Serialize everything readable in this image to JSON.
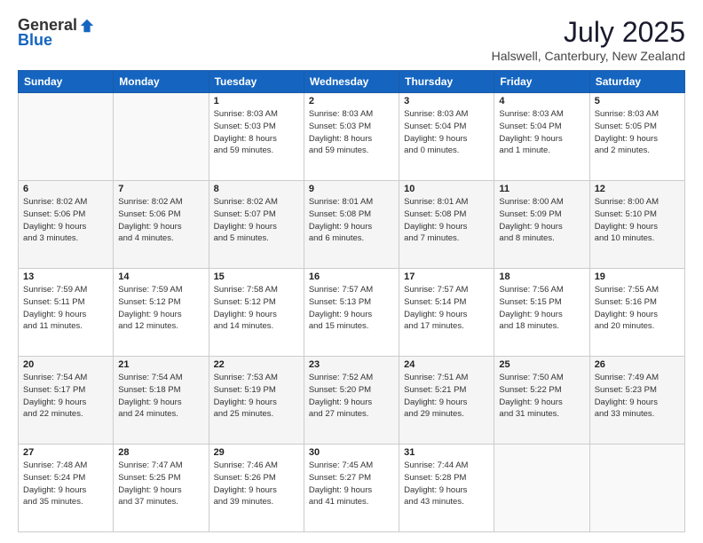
{
  "logo": {
    "general": "General",
    "blue": "Blue"
  },
  "header": {
    "month": "July 2025",
    "location": "Halswell, Canterbury, New Zealand"
  },
  "weekdays": [
    "Sunday",
    "Monday",
    "Tuesday",
    "Wednesday",
    "Thursday",
    "Friday",
    "Saturday"
  ],
  "weeks": [
    [
      {
        "day": "",
        "text": ""
      },
      {
        "day": "",
        "text": ""
      },
      {
        "day": "1",
        "text": "Sunrise: 8:03 AM\nSunset: 5:03 PM\nDaylight: 8 hours\nand 59 minutes."
      },
      {
        "day": "2",
        "text": "Sunrise: 8:03 AM\nSunset: 5:03 PM\nDaylight: 8 hours\nand 59 minutes."
      },
      {
        "day": "3",
        "text": "Sunrise: 8:03 AM\nSunset: 5:04 PM\nDaylight: 9 hours\nand 0 minutes."
      },
      {
        "day": "4",
        "text": "Sunrise: 8:03 AM\nSunset: 5:04 PM\nDaylight: 9 hours\nand 1 minute."
      },
      {
        "day": "5",
        "text": "Sunrise: 8:03 AM\nSunset: 5:05 PM\nDaylight: 9 hours\nand 2 minutes."
      }
    ],
    [
      {
        "day": "6",
        "text": "Sunrise: 8:02 AM\nSunset: 5:06 PM\nDaylight: 9 hours\nand 3 minutes."
      },
      {
        "day": "7",
        "text": "Sunrise: 8:02 AM\nSunset: 5:06 PM\nDaylight: 9 hours\nand 4 minutes."
      },
      {
        "day": "8",
        "text": "Sunrise: 8:02 AM\nSunset: 5:07 PM\nDaylight: 9 hours\nand 5 minutes."
      },
      {
        "day": "9",
        "text": "Sunrise: 8:01 AM\nSunset: 5:08 PM\nDaylight: 9 hours\nand 6 minutes."
      },
      {
        "day": "10",
        "text": "Sunrise: 8:01 AM\nSunset: 5:08 PM\nDaylight: 9 hours\nand 7 minutes."
      },
      {
        "day": "11",
        "text": "Sunrise: 8:00 AM\nSunset: 5:09 PM\nDaylight: 9 hours\nand 8 minutes."
      },
      {
        "day": "12",
        "text": "Sunrise: 8:00 AM\nSunset: 5:10 PM\nDaylight: 9 hours\nand 10 minutes."
      }
    ],
    [
      {
        "day": "13",
        "text": "Sunrise: 7:59 AM\nSunset: 5:11 PM\nDaylight: 9 hours\nand 11 minutes."
      },
      {
        "day": "14",
        "text": "Sunrise: 7:59 AM\nSunset: 5:12 PM\nDaylight: 9 hours\nand 12 minutes."
      },
      {
        "day": "15",
        "text": "Sunrise: 7:58 AM\nSunset: 5:12 PM\nDaylight: 9 hours\nand 14 minutes."
      },
      {
        "day": "16",
        "text": "Sunrise: 7:57 AM\nSunset: 5:13 PM\nDaylight: 9 hours\nand 15 minutes."
      },
      {
        "day": "17",
        "text": "Sunrise: 7:57 AM\nSunset: 5:14 PM\nDaylight: 9 hours\nand 17 minutes."
      },
      {
        "day": "18",
        "text": "Sunrise: 7:56 AM\nSunset: 5:15 PM\nDaylight: 9 hours\nand 18 minutes."
      },
      {
        "day": "19",
        "text": "Sunrise: 7:55 AM\nSunset: 5:16 PM\nDaylight: 9 hours\nand 20 minutes."
      }
    ],
    [
      {
        "day": "20",
        "text": "Sunrise: 7:54 AM\nSunset: 5:17 PM\nDaylight: 9 hours\nand 22 minutes."
      },
      {
        "day": "21",
        "text": "Sunrise: 7:54 AM\nSunset: 5:18 PM\nDaylight: 9 hours\nand 24 minutes."
      },
      {
        "day": "22",
        "text": "Sunrise: 7:53 AM\nSunset: 5:19 PM\nDaylight: 9 hours\nand 25 minutes."
      },
      {
        "day": "23",
        "text": "Sunrise: 7:52 AM\nSunset: 5:20 PM\nDaylight: 9 hours\nand 27 minutes."
      },
      {
        "day": "24",
        "text": "Sunrise: 7:51 AM\nSunset: 5:21 PM\nDaylight: 9 hours\nand 29 minutes."
      },
      {
        "day": "25",
        "text": "Sunrise: 7:50 AM\nSunset: 5:22 PM\nDaylight: 9 hours\nand 31 minutes."
      },
      {
        "day": "26",
        "text": "Sunrise: 7:49 AM\nSunset: 5:23 PM\nDaylight: 9 hours\nand 33 minutes."
      }
    ],
    [
      {
        "day": "27",
        "text": "Sunrise: 7:48 AM\nSunset: 5:24 PM\nDaylight: 9 hours\nand 35 minutes."
      },
      {
        "day": "28",
        "text": "Sunrise: 7:47 AM\nSunset: 5:25 PM\nDaylight: 9 hours\nand 37 minutes."
      },
      {
        "day": "29",
        "text": "Sunrise: 7:46 AM\nSunset: 5:26 PM\nDaylight: 9 hours\nand 39 minutes."
      },
      {
        "day": "30",
        "text": "Sunrise: 7:45 AM\nSunset: 5:27 PM\nDaylight: 9 hours\nand 41 minutes."
      },
      {
        "day": "31",
        "text": "Sunrise: 7:44 AM\nSunset: 5:28 PM\nDaylight: 9 hours\nand 43 minutes."
      },
      {
        "day": "",
        "text": ""
      },
      {
        "day": "",
        "text": ""
      }
    ]
  ]
}
